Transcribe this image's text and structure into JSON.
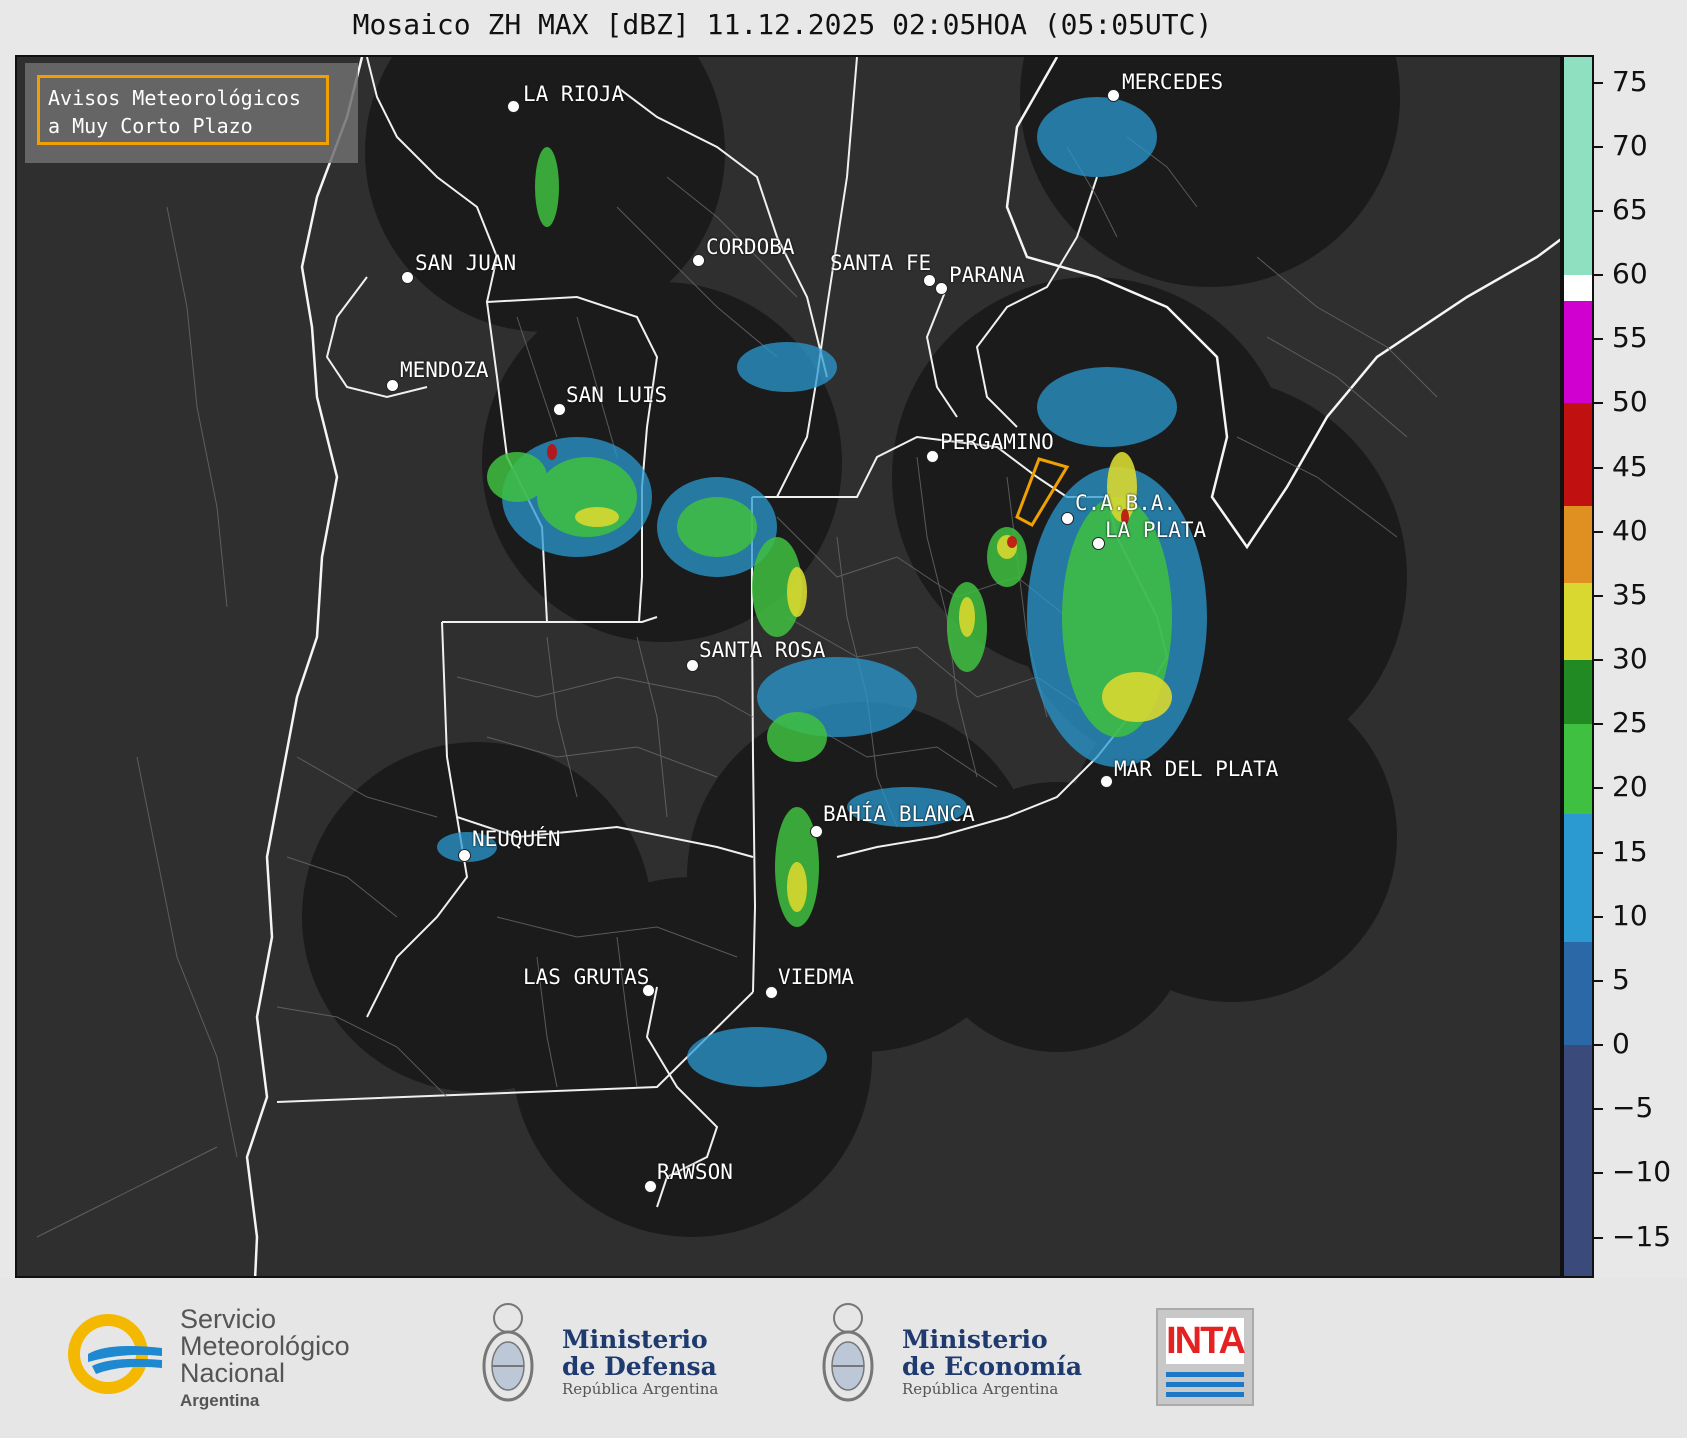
{
  "title": "Mosaico ZH MAX [dBZ] 11.12.2025 02:05HOA (05:05UTC)",
  "warning": {
    "line1": "Avisos Meteorológicos",
    "line2": "a Muy Corto Plazo",
    "border_color": "#f0a000"
  },
  "cities": [
    {
      "name": "LA RIOJA"
    },
    {
      "name": "MERCEDES"
    },
    {
      "name": "SAN JUAN"
    },
    {
      "name": "CORDOBA"
    },
    {
      "name": "SANTA FE"
    },
    {
      "name": "PARANA"
    },
    {
      "name": "MENDOZA"
    },
    {
      "name": "SAN LUIS"
    },
    {
      "name": "PERGAMINO"
    },
    {
      "name": "C.A.B.A."
    },
    {
      "name": "LA PLATA"
    },
    {
      "name": "SANTA ROSA"
    },
    {
      "name": "MAR DEL PLATA"
    },
    {
      "name": "BAHÍA BLANCA"
    },
    {
      "name": "NEUQUÉN"
    },
    {
      "name": "LAS GRUTAS"
    },
    {
      "name": "VIEDMA"
    },
    {
      "name": "RAWSON"
    }
  ],
  "colorbar": {
    "min": -18,
    "max": 77,
    "ticks": [
      "75",
      "70",
      "65",
      "60",
      "55",
      "50",
      "45",
      "40",
      "35",
      "30",
      "25",
      "20",
      "15",
      "10",
      "5",
      "0",
      "−5",
      "−10",
      "−15"
    ],
    "stops": [
      {
        "from": -18,
        "to": 0,
        "color": "#3a4a7a"
      },
      {
        "from": 0,
        "to": 8,
        "color": "#2a68a8"
      },
      {
        "from": 8,
        "to": 18,
        "color": "#2a9ad0"
      },
      {
        "from": 18,
        "to": 25,
        "color": "#40c040"
      },
      {
        "from": 25,
        "to": 30,
        "color": "#228a22"
      },
      {
        "from": 30,
        "to": 36,
        "color": "#d8d830"
      },
      {
        "from": 36,
        "to": 42,
        "color": "#e09020"
      },
      {
        "from": 42,
        "to": 50,
        "color": "#c01010"
      },
      {
        "from": 50,
        "to": 58,
        "color": "#d000d0"
      },
      {
        "from": 58,
        "to": 60,
        "color": "#ffffff"
      },
      {
        "from": 60,
        "to": 77,
        "color": "#8ee0c0"
      }
    ]
  },
  "footer": {
    "smn_line1": "Servicio",
    "smn_line2": "Meteorológico",
    "smn_line3": "Nacional",
    "smn_line4": "Argentina",
    "defensa_line1": "Ministerio",
    "defensa_line2": "de Defensa",
    "defensa_line3": "República Argentina",
    "economia_line1": "Ministerio",
    "economia_line2": "de Economía",
    "economia_line3": "República Argentina",
    "inta": "INTA"
  }
}
